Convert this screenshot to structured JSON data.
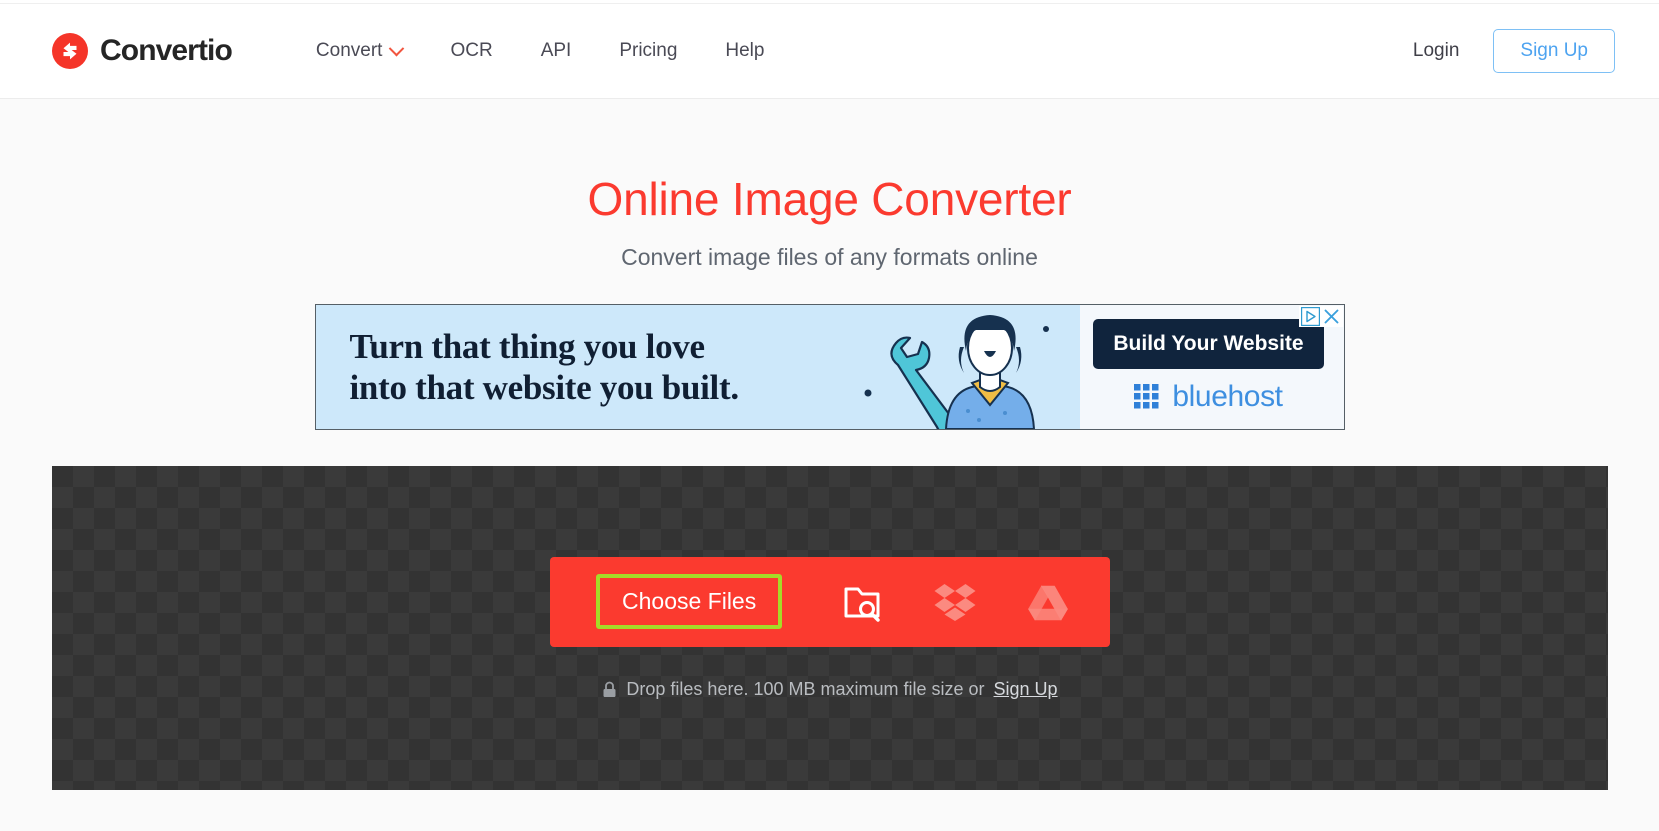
{
  "header": {
    "brand": {
      "name": "Convertio",
      "icon": "convert-arrows-icon",
      "color": "#f53529"
    },
    "nav": [
      {
        "label": "Convert",
        "has_dropdown": true,
        "icon": "chevron-down-icon"
      },
      {
        "label": "OCR",
        "has_dropdown": false
      },
      {
        "label": "API",
        "has_dropdown": false
      },
      {
        "label": "Pricing",
        "has_dropdown": false
      },
      {
        "label": "Help",
        "has_dropdown": false
      }
    ],
    "login_label": "Login",
    "signup_label": "Sign Up"
  },
  "hero": {
    "title": "Online Image Converter",
    "subtitle": "Convert image files of any formats online",
    "title_color": "#fb3a2f"
  },
  "ad": {
    "headline_line1": "Turn that thing you love",
    "headline_line2": "into that website you built.",
    "cta_label": "Build Your Website",
    "brand_name": "bluehost",
    "adchoices_icon": "adchoices-triangle-icon",
    "close_icon": "close-x-icon",
    "bg_color": "#cde8fa",
    "cta_color": "#10243d"
  },
  "dropzone": {
    "choose_files_label": "Choose Files",
    "focus_ring_color": "#a5db28",
    "bar_color": "#fb3a2f",
    "sources": [
      {
        "name": "folder-search-icon",
        "label": "From Computer"
      },
      {
        "name": "dropbox-icon",
        "label": "From Dropbox"
      },
      {
        "name": "google-drive-icon",
        "label": "From Google Drive"
      }
    ],
    "note_lock_icon": "lock-icon",
    "note_text": "Drop files here. 100 MB maximum file size or",
    "note_link": "Sign Up"
  }
}
